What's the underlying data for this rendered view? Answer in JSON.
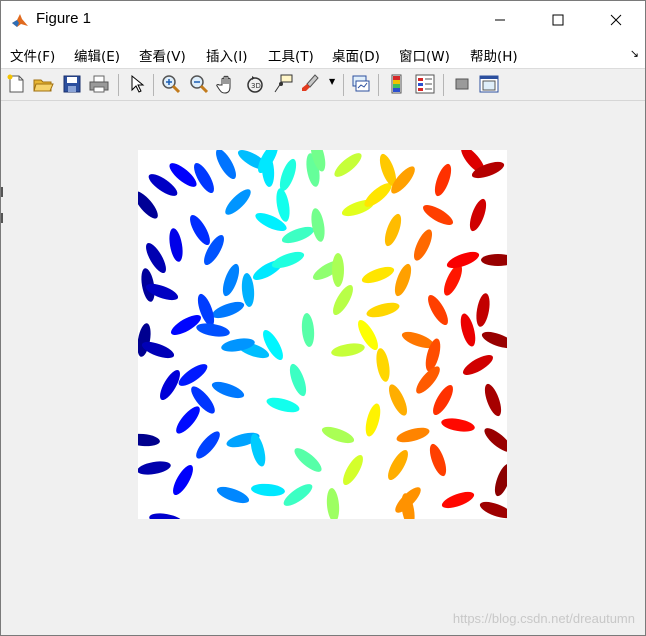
{
  "window": {
    "title": "Figure 1"
  },
  "menu": [
    {
      "label": "文件(F)"
    },
    {
      "label": "编辑(E)"
    },
    {
      "label": "查看(V)"
    },
    {
      "label": "插入(I)"
    },
    {
      "label": "工具(T)"
    },
    {
      "label": "桌面(D)"
    },
    {
      "label": "窗口(W)"
    },
    {
      "label": "帮助(H)"
    }
  ],
  "toolbar": {
    "icons": [
      "new-figure-icon",
      "open-file-icon",
      "save-icon",
      "print-icon",
      "select-pointer-icon",
      "zoom-in-icon",
      "zoom-out-icon",
      "pan-hand-icon",
      "rotate-3d-icon",
      "data-cursor-icon",
      "brush-icon",
      "link-plot-icon",
      "colorbar-icon",
      "legend-icon",
      "hide-plot-tools-icon",
      "show-plot-tools-icon"
    ]
  },
  "figure": {
    "image_type": "labeled rice grains colored with jet colormap"
  },
  "watermark": "https://blog.csdn.net/dreautumn",
  "colors": {
    "titlebar": "#ffffff",
    "menubar": "#ffffff",
    "toolbar": "#f0f0f0",
    "canvas": "#f0f0f0"
  }
}
